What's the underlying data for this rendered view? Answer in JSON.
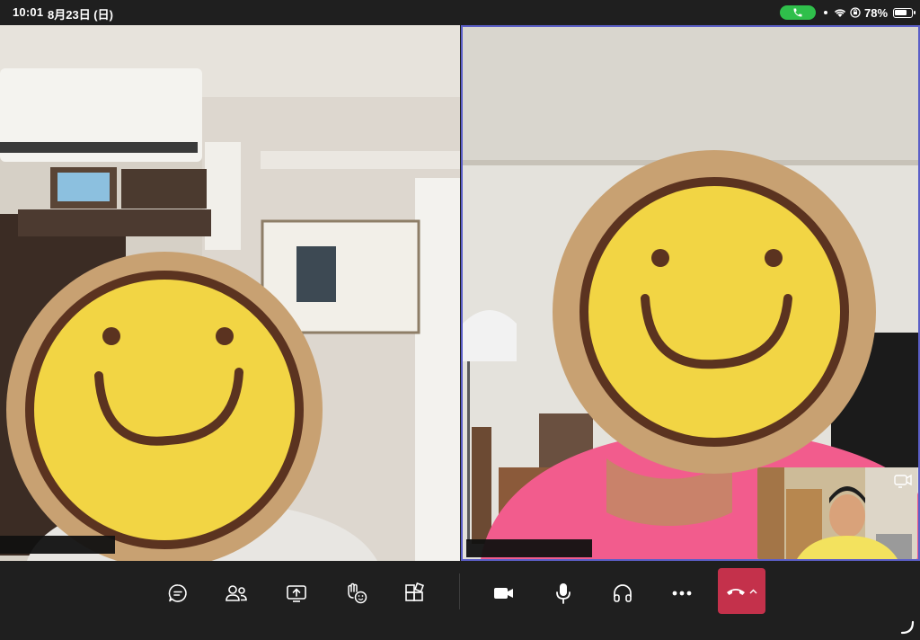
{
  "status_bar": {
    "time": "10:01",
    "date": "8月23日 (日)",
    "battery_percent": "78%",
    "battery_level": 0.78,
    "call_indicator_color": "#2fbf4b"
  },
  "participants": [
    {
      "id": "participant-left",
      "name_hidden": true
    },
    {
      "id": "participant-right",
      "name_hidden": true,
      "active_speaker": true
    }
  ],
  "self_view": {
    "icon": "camera-switch-icon"
  },
  "toolbar": {
    "buttons": [
      {
        "name": "chat-button",
        "icon": "chat-icon"
      },
      {
        "name": "participants-button",
        "icon": "people-icon"
      },
      {
        "name": "share-button",
        "icon": "share-screen-icon"
      },
      {
        "name": "reactions-button",
        "icon": "raise-hand-icon"
      },
      {
        "name": "apps-button",
        "icon": "apps-icon"
      },
      {
        "name": "camera-button",
        "icon": "video-camera-icon"
      },
      {
        "name": "mic-button",
        "icon": "microphone-icon"
      },
      {
        "name": "audio-button",
        "icon": "headphones-icon"
      },
      {
        "name": "more-button",
        "icon": "more-icon"
      }
    ],
    "hangup": {
      "icon": "hang-up-icon",
      "color": "#c4314b"
    }
  },
  "colors": {
    "accent": "#5b5fc7",
    "toolbar_bg": "#1f1f1f",
    "hangup": "#c4314b"
  }
}
